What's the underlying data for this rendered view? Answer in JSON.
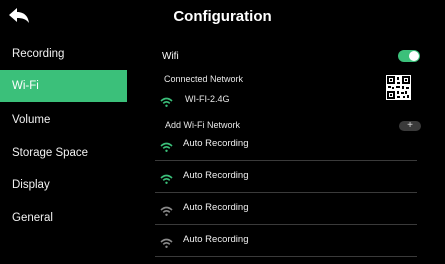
{
  "header": {
    "title": "Configuration",
    "back_icon": "back-arrow-icon"
  },
  "sidebar": {
    "items": [
      {
        "label": "Recording",
        "active": false
      },
      {
        "label": "Wi-Fi",
        "active": true
      },
      {
        "label": "Volume",
        "active": false
      },
      {
        "label": "Storage Space",
        "active": false
      },
      {
        "label": "Display",
        "active": false
      },
      {
        "label": "General",
        "active": false
      }
    ]
  },
  "wifi": {
    "label": "Wifi",
    "enabled": true,
    "connected_label": "Connected Network",
    "connected_ssid": "WI-FI-2.4G",
    "add_label": "Add  Wi-Fi Network",
    "add_button": "+",
    "networks": [
      {
        "name": "Auto Recording",
        "signal": "strong"
      },
      {
        "name": "Auto Recording",
        "signal": "strong"
      },
      {
        "name": "Auto Recording",
        "signal": "weak"
      },
      {
        "name": "Auto Recording",
        "signal": "weak"
      }
    ]
  },
  "colors": {
    "accent": "#3bc07a",
    "background": "#000000",
    "signal_strong": "#3bc07a",
    "signal_weak": "#8a8a8a"
  }
}
